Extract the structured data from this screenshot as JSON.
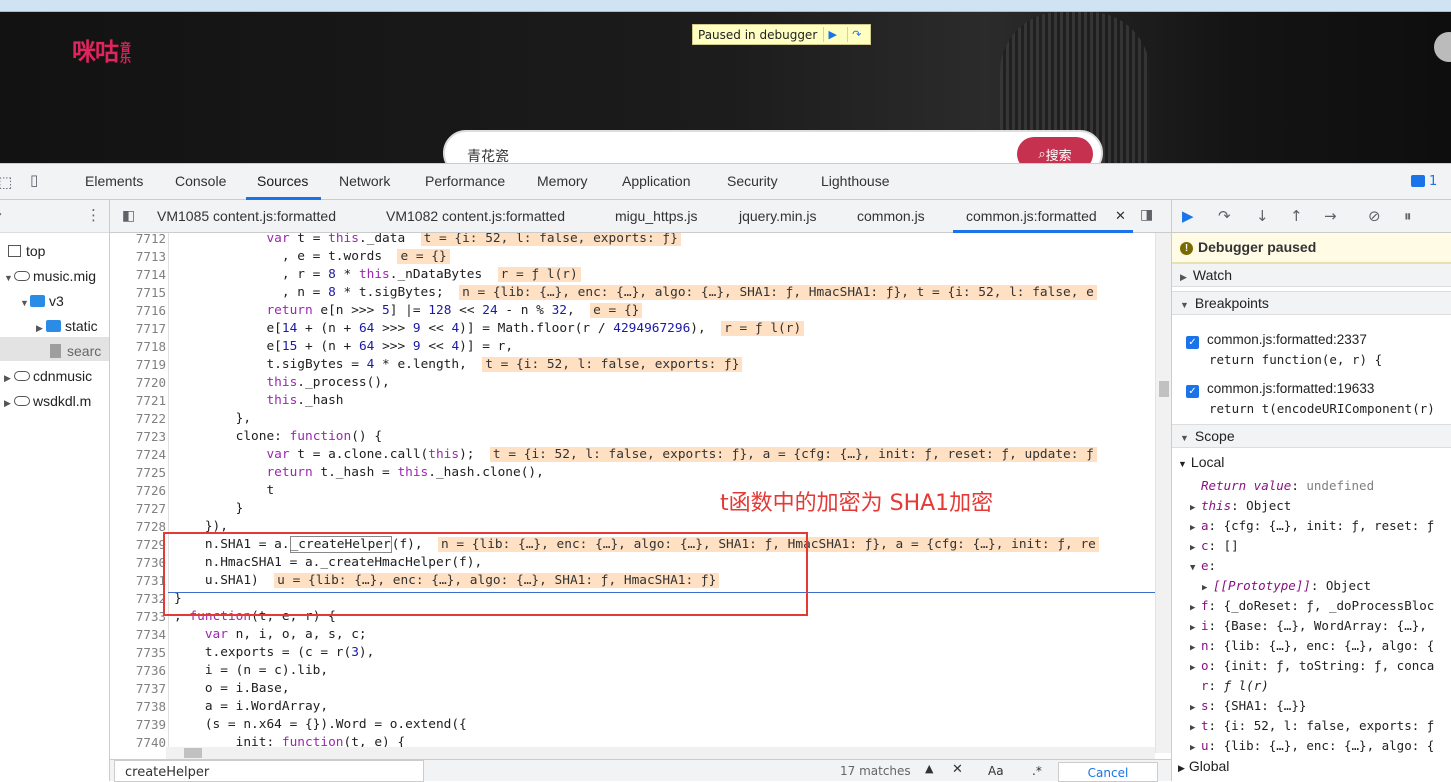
{
  "site": {
    "logo": "咪咕",
    "logo_sub": "音乐",
    "paused_label": "Paused in debugger",
    "search_query": "青花瓷",
    "search_button": "搜索"
  },
  "devtools": {
    "panels": [
      "Elements",
      "Console",
      "Sources",
      "Network",
      "Performance",
      "Memory",
      "Application",
      "Security",
      "Lighthouse"
    ],
    "active_panel": "Sources",
    "issues_count": "1"
  },
  "navigator": {
    "items": [
      "top",
      "music.mig",
      "v3",
      "static",
      "searc",
      "cdnmusic",
      "wsdkdl.m"
    ]
  },
  "editor": {
    "tabs": [
      "VM1085 content.js:formatted",
      "VM1082 content.js:formatted",
      "migu_https.js",
      "jquery.min.js",
      "common.js",
      "common.js:formatted"
    ],
    "active_tab": "common.js:formatted",
    "line_numbers": [
      "7712",
      "7713",
      "7714",
      "7715",
      "7716",
      "7717",
      "7718",
      "7719",
      "7720",
      "7721",
      "7722",
      "7723",
      "7724",
      "7725",
      "7726",
      "7727",
      "7728",
      "7729",
      "7730",
      "7731",
      "7732",
      "7733",
      "7734",
      "7735",
      "7736",
      "7737",
      "7738",
      "7739",
      "7740"
    ],
    "annotation": "t函数中的加密为 SHA1加密",
    "find_query": "createHelper",
    "find_count": "17 matches",
    "find_case": "Aa",
    "find_cancel": "Cancel"
  },
  "debugger": {
    "status": "Debugger paused",
    "watch_label": "Watch",
    "breakpoints_label": "Breakpoints",
    "breakpoints": [
      {
        "file": "common.js:formatted:2337",
        "code": "return function(e, r) {"
      },
      {
        "file": "common.js:formatted:19633",
        "code": "return t(encodeURIComponent(r)"
      }
    ],
    "scope_label": "Scope",
    "local_label": "Local",
    "global_label": "Global",
    "scope_items": [
      {
        "name": "Return value",
        "value": "undefined"
      },
      {
        "name": "this",
        "value": "Object"
      },
      {
        "name": "a",
        "value": "{cfg: {…}, init: ƒ, reset: ƒ"
      },
      {
        "name": "c",
        "value": "[]"
      },
      {
        "name": "e",
        "value": ""
      },
      {
        "name": "[[Prototype]]",
        "value": "Object"
      },
      {
        "name": "f",
        "value": "{_doReset: ƒ, _doProcessBloc"
      },
      {
        "name": "i",
        "value": "{Base: {…}, WordArray: {…},"
      },
      {
        "name": "n",
        "value": "{lib: {…}, enc: {…}, algo: {"
      },
      {
        "name": "o",
        "value": "{init: ƒ, toString: ƒ, conca"
      },
      {
        "name": "r",
        "value": "ƒ l(r)"
      },
      {
        "name": "s",
        "value": "{SHA1: {…}}"
      },
      {
        "name": "t",
        "value": "{i: 52, l: false, exports: ƒ"
      },
      {
        "name": "u",
        "value": "{lib: {…}, enc: {…}, algo: {"
      }
    ]
  }
}
